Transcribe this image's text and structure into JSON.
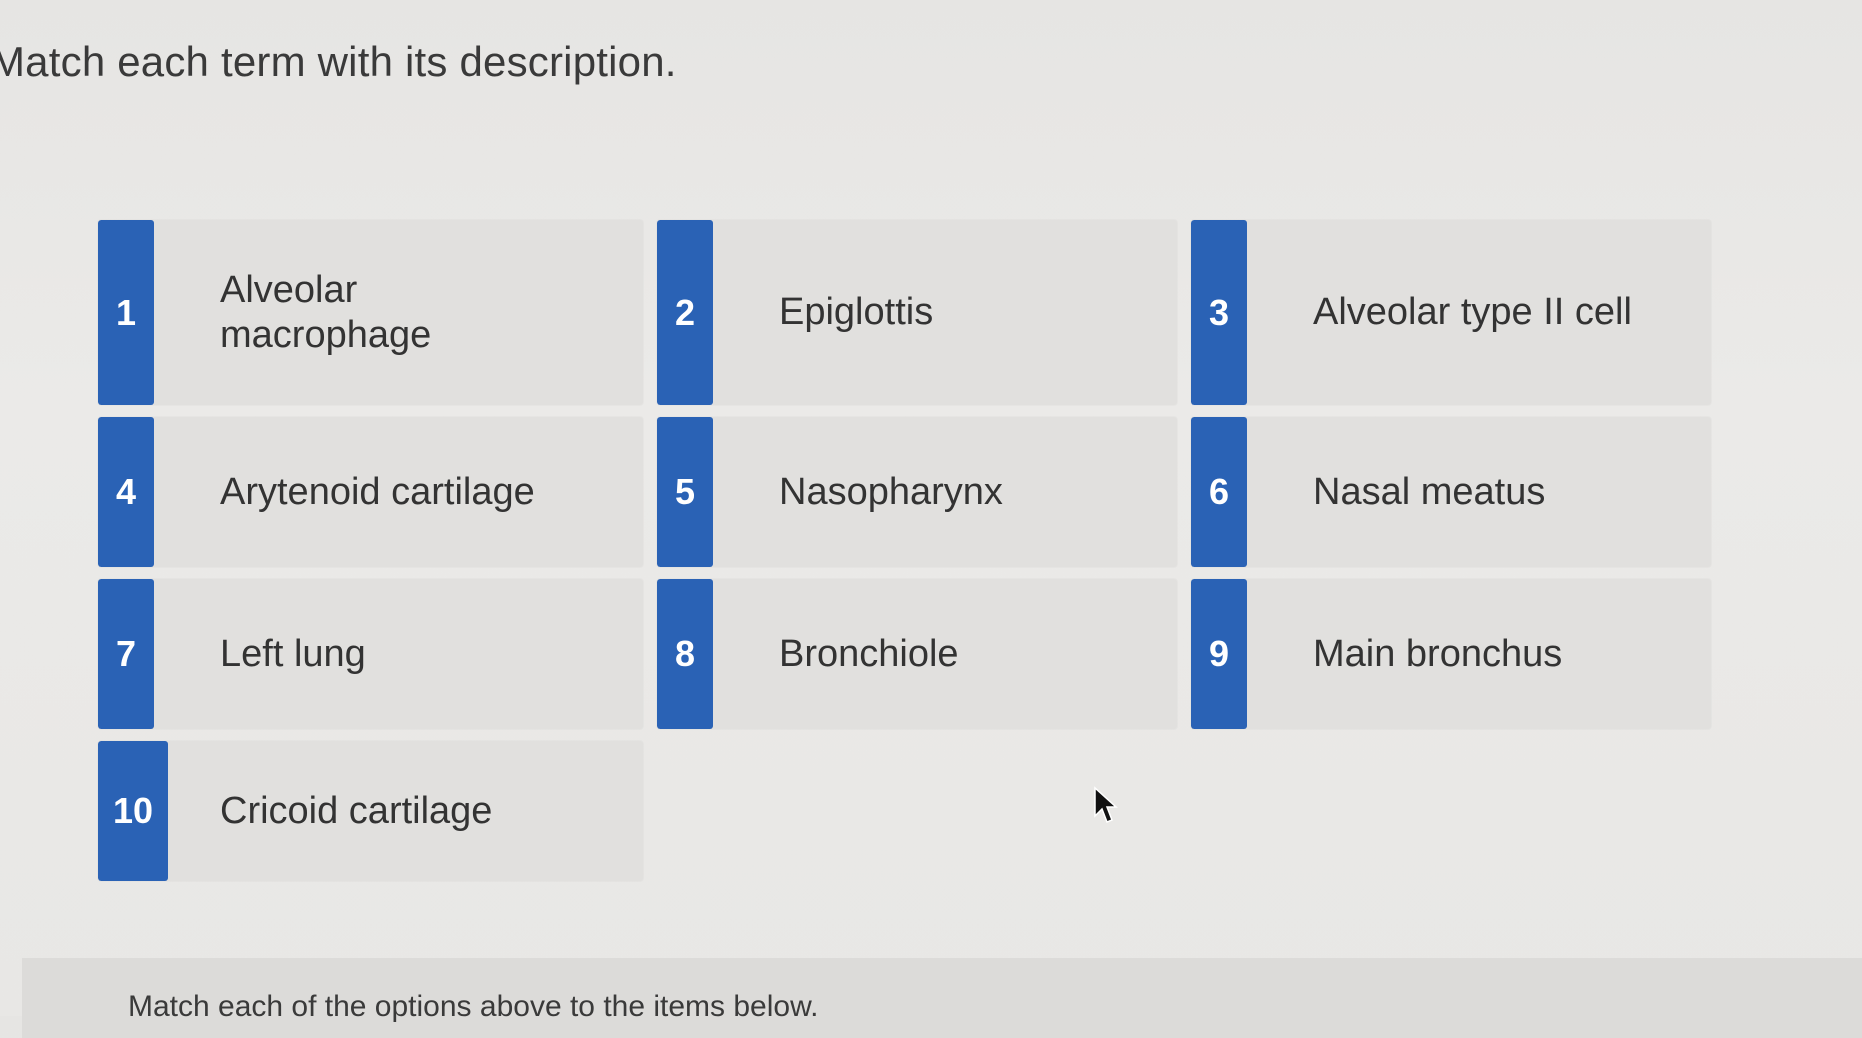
{
  "prompt": "Match each term with its description.",
  "terms": [
    {
      "number": "1",
      "label": "Alveolar macrophage"
    },
    {
      "number": "2",
      "label": "Epiglottis"
    },
    {
      "number": "3",
      "label": "Alveolar type II cell"
    },
    {
      "number": "4",
      "label": "Arytenoid cartilage"
    },
    {
      "number": "5",
      "label": "Nasopharynx"
    },
    {
      "number": "6",
      "label": "Nasal meatus"
    },
    {
      "number": "7",
      "label": "Left lung"
    },
    {
      "number": "8",
      "label": "Bronchiole"
    },
    {
      "number": "9",
      "label": "Main bronchus"
    },
    {
      "number": "10",
      "label": "Cricoid cartilage"
    }
  ],
  "instruction": "Match each of the options above to the items below.",
  "colors": {
    "badge": "#2a62b5",
    "card": "#e1e0de",
    "background": "#e8e7e5"
  }
}
